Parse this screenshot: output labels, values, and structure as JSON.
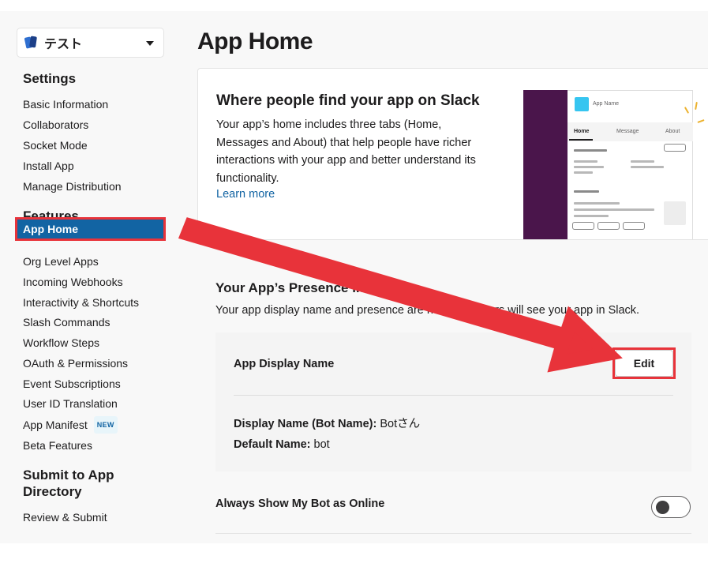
{
  "app_selector": {
    "name": "テスト"
  },
  "sidebar": {
    "settings_title": "Settings",
    "settings_items": [
      "Basic Information",
      "Collaborators",
      "Socket Mode",
      "Install App",
      "Manage Distribution"
    ],
    "features_title": "Features",
    "features_items": [
      "App Home",
      "Org Level Apps",
      "Incoming Webhooks",
      "Interactivity & Shortcuts",
      "Slash Commands",
      "Workflow Steps",
      "OAuth & Permissions",
      "Event Subscriptions",
      "User ID Translation",
      "App Manifest",
      "Beta Features"
    ],
    "new_badge": "NEW",
    "submit_title_line1": "Submit to App",
    "submit_title_line2": "Directory",
    "submit_items": [
      "Review & Submit"
    ]
  },
  "main": {
    "page_title": "App Home",
    "info_card": {
      "heading": "Where people find your app on Slack",
      "body": "Your app’s home includes three tabs (Home, Messages and About) that help people have richer interactions with your app and better understand its functionality.",
      "link": "Learn more",
      "illustration": {
        "app_name": "App Name",
        "tabs": [
          "Home",
          "Message",
          "About"
        ]
      }
    },
    "presence": {
      "title": "Your App’s Presence in Slack",
      "description": "Your app display name and presence are how your users will see your app in Slack.",
      "display_name_label": "App Display Name",
      "edit_label": "Edit",
      "bot_name_key": "Display Name (Bot Name):",
      "bot_name_value": "Botさん",
      "default_name_key": "Default Name:",
      "default_name_value": "bot"
    },
    "online": {
      "label": "Always Show My Bot as Online",
      "toggle_on": false
    }
  },
  "colors": {
    "accent": "#1264a3",
    "highlight": "#e8333a",
    "sidebar_purple": "#4a154b"
  }
}
